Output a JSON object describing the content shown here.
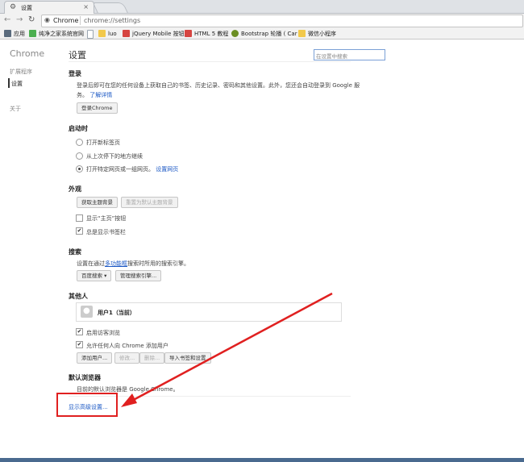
{
  "browser": {
    "tab_title": "设置",
    "omnibox_host": "Chrome",
    "omnibox_path": "chrome://settings"
  },
  "bookmarks": [
    {
      "label": "应用",
      "color": "#5a6b7d"
    },
    {
      "label": "纯净之家系统官网",
      "color": "#4caf50"
    },
    {
      "label": "",
      "color": "#9aa5b1"
    },
    {
      "label": "luo",
      "color": "#f2c94c"
    },
    {
      "label": "jQuery Mobile 按钮",
      "color": "#d64541"
    },
    {
      "label": "HTML 5 教程",
      "color": "#d64541"
    },
    {
      "label": "Bootstrap 轮播 ( Car",
      "color": "#6b8e23"
    },
    {
      "label": "微信小程序",
      "color": "#f2c94c"
    }
  ],
  "sidebar": {
    "title": "Chrome",
    "items": [
      "扩展程序",
      "设置",
      "关于"
    ]
  },
  "main": {
    "title": "设置",
    "search_placeholder": "在设置中搜索",
    "signin": {
      "heading": "登录",
      "desc1": "登录后即可在您的任何设备上获取自己的书签、历史记录、密码和其他设置。此外，您还会自动登录到 Google 服",
      "desc2": "务。",
      "learn_more": "了解详情",
      "button": "登录Chrome"
    },
    "startup": {
      "heading": "启动时",
      "options": [
        "打开新标签页",
        "从上次停下的地方继续",
        "打开特定网页或一组网页。"
      ],
      "set_pages": "设置网页"
    },
    "appearance": {
      "heading": "外观",
      "get_themes": "获取主题背景",
      "reset_theme": "重置为默认主题背景",
      "show_home": "显示“主页”按钮",
      "show_bookmarks": "总是显示书签栏"
    },
    "search": {
      "heading": "搜索",
      "desc_prefix": "设置在通过",
      "desc_link": "多功能框",
      "desc_suffix": "搜索时所用的搜索引擎。",
      "engine": "百度搜索",
      "manage": "管理搜索引擎..."
    },
    "people": {
      "heading": "其他人",
      "user": "用户1（当前）",
      "guest": "启用访客浏览",
      "allow_add": "允许任何人向 Chrome 添加用户",
      "add": "添加用户...",
      "edit": "修改...",
      "remove": "删除...",
      "import": "导入书签和设置"
    },
    "default_browser": {
      "heading": "默认浏览器",
      "desc": "目前的默认浏览器是 Google Chrome。"
    },
    "advanced": "显示高级设置..."
  },
  "annotation_color": "#e02020"
}
